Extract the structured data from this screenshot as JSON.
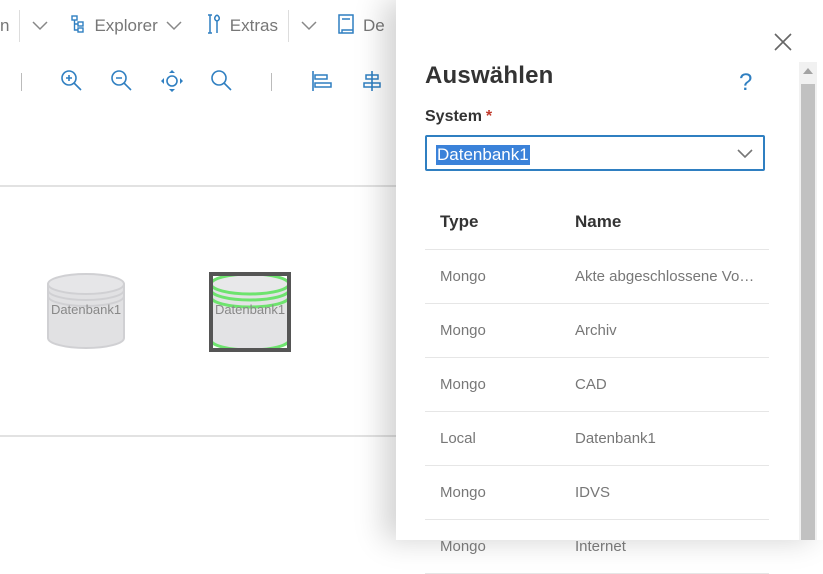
{
  "menubar": {
    "partial_left": "n",
    "explorer_label": "Explorer",
    "extras_label": "Extras",
    "partial_right": "De"
  },
  "canvas": {
    "nodes": [
      {
        "label": "Datenbank1",
        "selected": false
      },
      {
        "label": "Datenbank1",
        "selected": true
      }
    ]
  },
  "dialog": {
    "title": "Auswählen",
    "help": "?",
    "field_label": "System",
    "required_mark": "*",
    "select_value": "Datenbank1",
    "columns": {
      "type": "Type",
      "name": "Name"
    },
    "rows": [
      {
        "type": "Mongo",
        "name": "Akte abgeschlossene Vorgänge"
      },
      {
        "type": "Mongo",
        "name": "Archiv"
      },
      {
        "type": "Mongo",
        "name": "CAD"
      },
      {
        "type": "Local",
        "name": "Datenbank1"
      },
      {
        "type": "Mongo",
        "name": "IDVS"
      },
      {
        "type": "Mongo",
        "name": "Internet"
      }
    ]
  },
  "colors": {
    "accent": "#2f7fc1",
    "selection_bg": "#3b82d9",
    "node_selected_glow": "#6ee36e",
    "required": "#c0392b"
  }
}
